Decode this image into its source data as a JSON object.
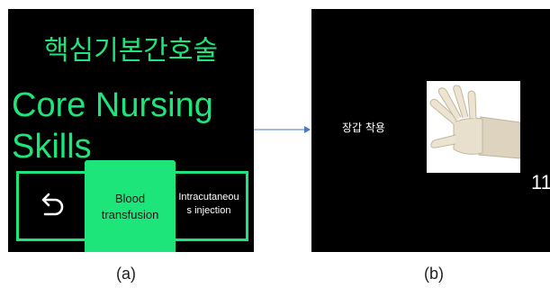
{
  "panel_a": {
    "title_ko": "핵심기본간호술",
    "title_en": "Core Nursing\nSkills",
    "back_icon": "undo-arrow-icon",
    "menu": {
      "selected_label": "Blood transfusion",
      "next_label": "Intracutaneous injection"
    },
    "caption": "(a)"
  },
  "panel_b": {
    "step_label": "장갑 착용",
    "image_icon": "glove-hand-image",
    "counter": "11",
    "caption": "(b)"
  },
  "colors": {
    "accent_green": "#1ee57a",
    "panel_bg": "#000000",
    "arrow_blue": "#4a78c8"
  }
}
